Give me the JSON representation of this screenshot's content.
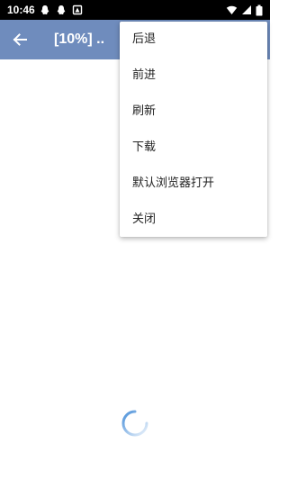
{
  "status_bar": {
    "time": "10:46",
    "left_icons": [
      "qq-icon",
      "qq-icon",
      "notification-icon"
    ],
    "right_icons": [
      "wifi-icon",
      "signal-icon",
      "battery-icon"
    ]
  },
  "app_bar": {
    "title": "[10%] ..",
    "background_color": "#6f8cbd",
    "back_icon": "arrow-back-icon"
  },
  "menu": {
    "items": [
      {
        "label": "后退"
      },
      {
        "label": "前进"
      },
      {
        "label": "刷新"
      },
      {
        "label": "下载"
      },
      {
        "label": "默认浏览器打开"
      },
      {
        "label": "关闭"
      }
    ]
  },
  "loading": {
    "icon": "loading-spinner-icon",
    "color": "#4a90d9"
  }
}
